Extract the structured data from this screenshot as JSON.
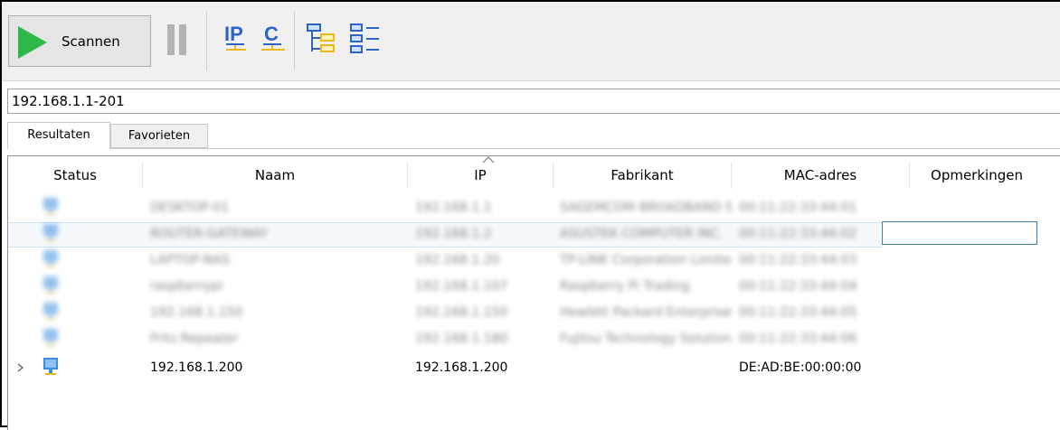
{
  "toolbar": {
    "scan_label": "Scannen",
    "icons": [
      "play-icon",
      "pause-icon",
      "ip-range-icon",
      "c-class-icon",
      "expand-tree-icon",
      "collapse-list-icon"
    ],
    "ip_icon_text": "IP",
    "c_icon_text": "C"
  },
  "address": {
    "value": "192.168.1.1-201"
  },
  "tabs": [
    {
      "label": "Resultaten",
      "active": true
    },
    {
      "label": "Favorieten",
      "active": false
    }
  ],
  "table": {
    "columns": [
      "Status",
      "Naam",
      "IP",
      "Fabrikant",
      "MAC-adres",
      "Opmerkingen"
    ],
    "sorted_column": "IP",
    "rows": [
      {
        "naam": "DESKTOP-01",
        "ip": "192.168.1.1",
        "fabrikant": "SAGEMCOM BROADBAND SAS",
        "mac": "00:11:22:33:44:01",
        "opmerkingen": ""
      },
      {
        "naam": "ROUTER-GATEWAY",
        "ip": "192.168.1.2",
        "fabrikant": "ASUSTEK COMPUTER INC.",
        "mac": "00:11:22:33:44:02",
        "opmerkingen": ""
      },
      {
        "naam": "LAPTOP-NAS",
        "ip": "192.168.1.20",
        "fabrikant": "TP-LINK Corporation Limited",
        "mac": "00:11:22:33:44:03",
        "opmerkingen": ""
      },
      {
        "naam": "raspberrypi",
        "ip": "192.168.1.107",
        "fabrikant": "Raspberry Pi Trading",
        "mac": "00:11:22:33:44:04",
        "opmerkingen": ""
      },
      {
        "naam": "192.168.1.150",
        "ip": "192.168.1.150",
        "fabrikant": "Hewlett Packard Enterprise",
        "mac": "00:11:22:33:44:05",
        "opmerkingen": ""
      },
      {
        "naam": "Fritz.Repeater",
        "ip": "192.168.1.180",
        "fabrikant": "Fujitsu Technology Solutions",
        "mac": "00:11:22:33:44:06",
        "opmerkingen": ""
      },
      {
        "naam": "192.168.1.200",
        "ip": "192.168.1.200",
        "fabrikant": "",
        "mac": "DE:AD:BE:00:00:00",
        "opmerkingen": ""
      }
    ]
  },
  "colors": {
    "play_green": "#2fb84a",
    "device_blue": "#3b8ede",
    "icon_blue": "#2b63c6",
    "icon_yellow": "#e8b81d",
    "selection_border": "#3c7fb1"
  }
}
